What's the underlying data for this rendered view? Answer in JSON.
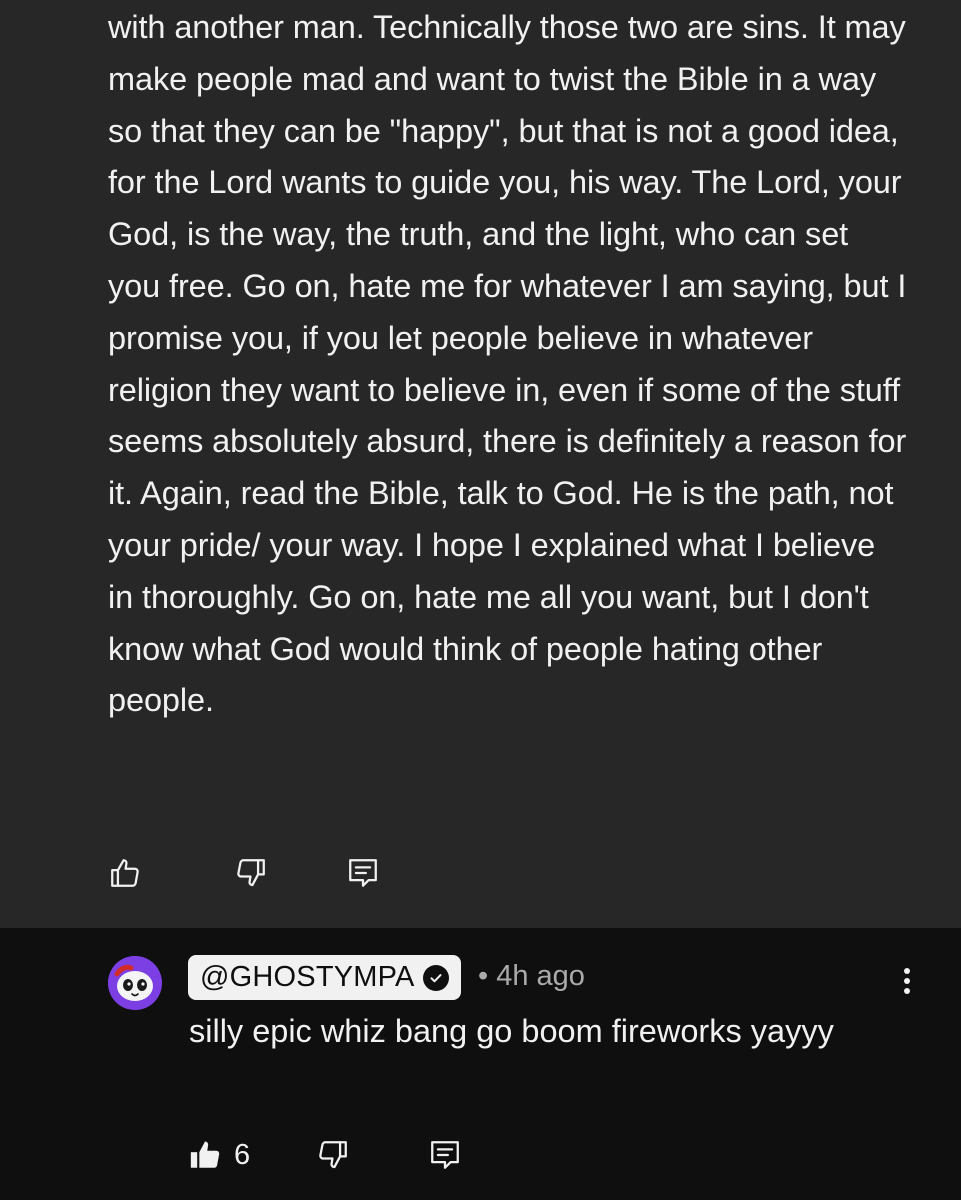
{
  "parent_comment": {
    "text": "with another man. Technically those two are sins. It may make people mad and want to twist the Bible in a way so that they can be \"happy\", but that is not a good idea, for the Lord wants to guide you, his way. The Lord, your God, is the way, the truth, and the light, who can set you free. Go on, hate me for whatever I am saying, but I promise you, if you let people believe in whatever religion they want to believe in, even if some of the stuff seems absolutely absurd, there is definitely a reason for it. Again, read the Bible, talk to God. He is the path, not your pride/ your way. I hope I explained what I believe in thoroughly. Go on, hate me all you want, but I don't know what God would think of people hating other people.",
    "actions": {
      "like_icon": "thumbs-up-outline-icon",
      "dislike_icon": "thumbs-down-outline-icon",
      "reply_icon": "reply-comment-icon"
    }
  },
  "reply": {
    "handle": "@GHOSTYMPA",
    "verified_icon": "verified-check-icon",
    "meta": "• 4h ago",
    "text": "silly epic whiz bang go boom fireworks yayyy",
    "like_count": "6",
    "actions": {
      "like_icon": "thumbs-up-filled-icon",
      "dislike_icon": "thumbs-down-outline-icon",
      "reply_icon": "reply-comment-icon",
      "more_icon": "more-vertical-icon"
    }
  },
  "colors": {
    "highlight_bg": "#272727",
    "page_bg": "#0f0f0f",
    "text": "#f1f1f1",
    "secondary_text": "#aaaaaa",
    "handle_chip_bg": "#f1f1f1",
    "avatar_accent": "#7b3fe4"
  }
}
